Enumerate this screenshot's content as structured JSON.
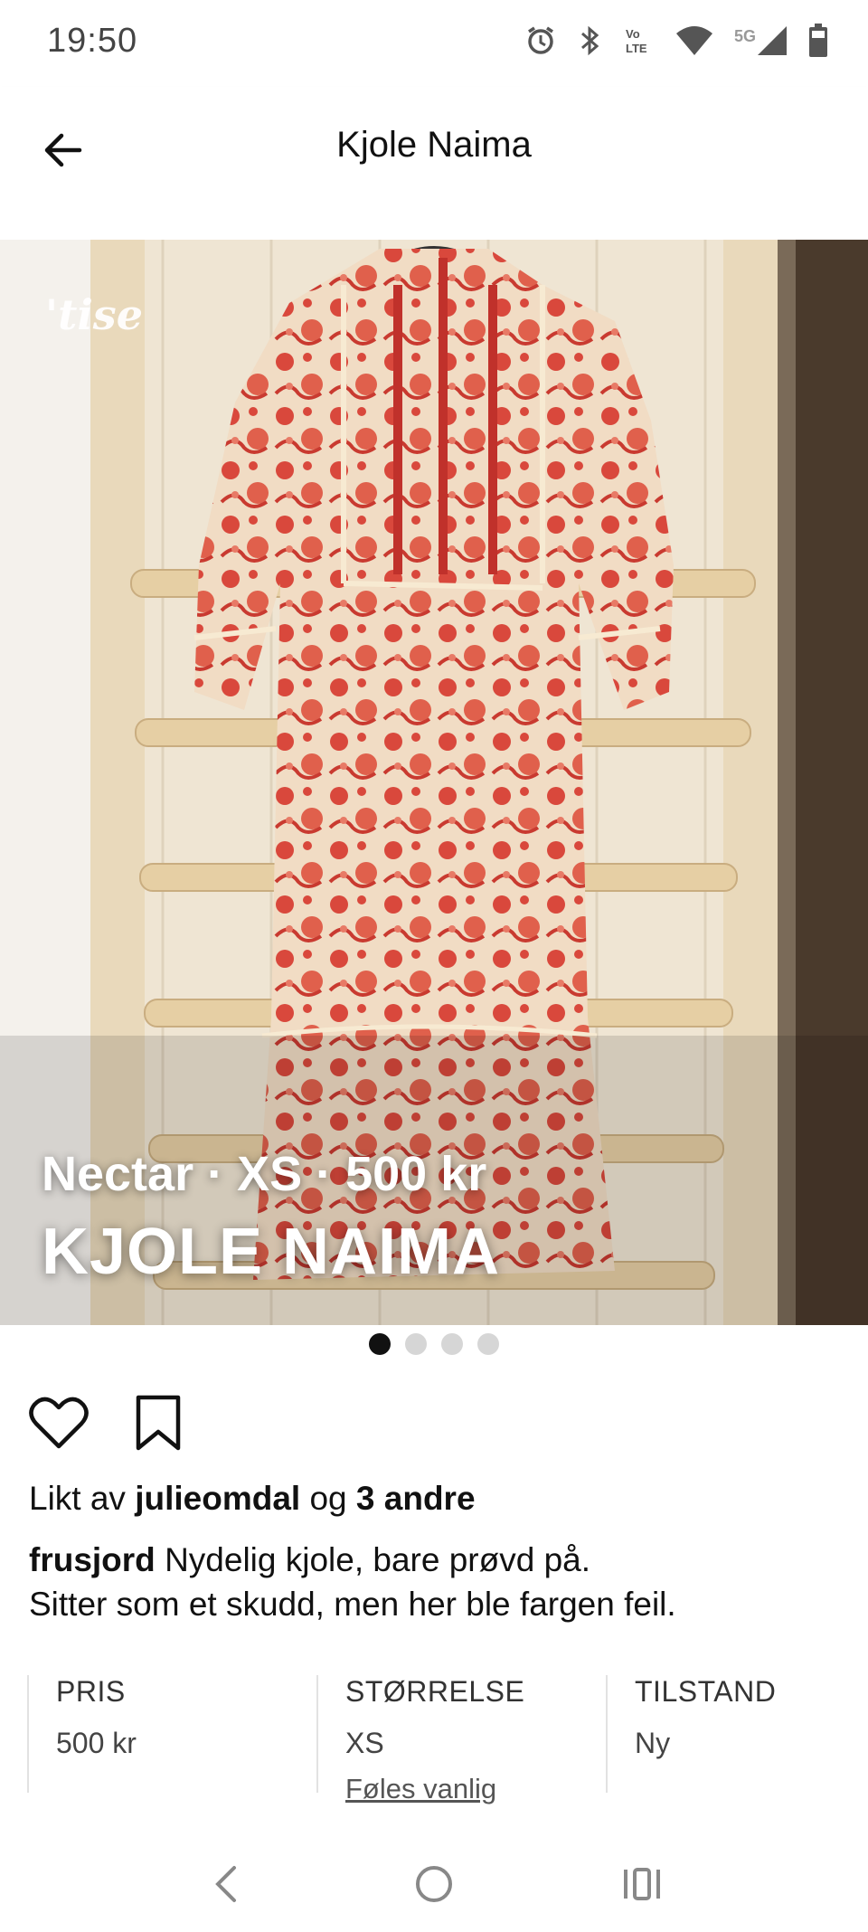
{
  "status_bar": {
    "time": "19:50",
    "icons": [
      "alarm-icon",
      "bluetooth-icon",
      "volte-icon",
      "wifi-icon",
      "signal-5g-icon",
      "battery-icon"
    ],
    "network_label": "5G"
  },
  "app_bar": {
    "title": "Kjole Naima",
    "back_icon": "arrow-left-icon"
  },
  "photo": {
    "watermark": "'tise",
    "meta": "Nectar · XS · 500 kr",
    "title": "KJOLE NAIMA",
    "page_count": 4,
    "active_page": 1
  },
  "actions": {
    "like_icon": "heart-icon",
    "save_icon": "bookmark-icon"
  },
  "likes": {
    "prefix": "Likt av",
    "user": "julieomdal",
    "conjunction": "og",
    "others": "3 andre"
  },
  "caption": {
    "user": "frusjord",
    "text": "Nydelig kjole, bare prøvd på.",
    "text_line2": "Sitter som et skudd, men her ble fargen feil."
  },
  "details": {
    "price_label": "PRIS",
    "price_value": "500 kr",
    "size_label": "STØRRELSE",
    "size_value": "XS",
    "size_fit_link": "Føles vanlig",
    "condition_label": "TILSTAND",
    "condition_value": "Ny"
  },
  "colors": {
    "dress_red": "#d9483c",
    "dress_cream": "#f1dcc4",
    "wall": "#efe5d3"
  }
}
